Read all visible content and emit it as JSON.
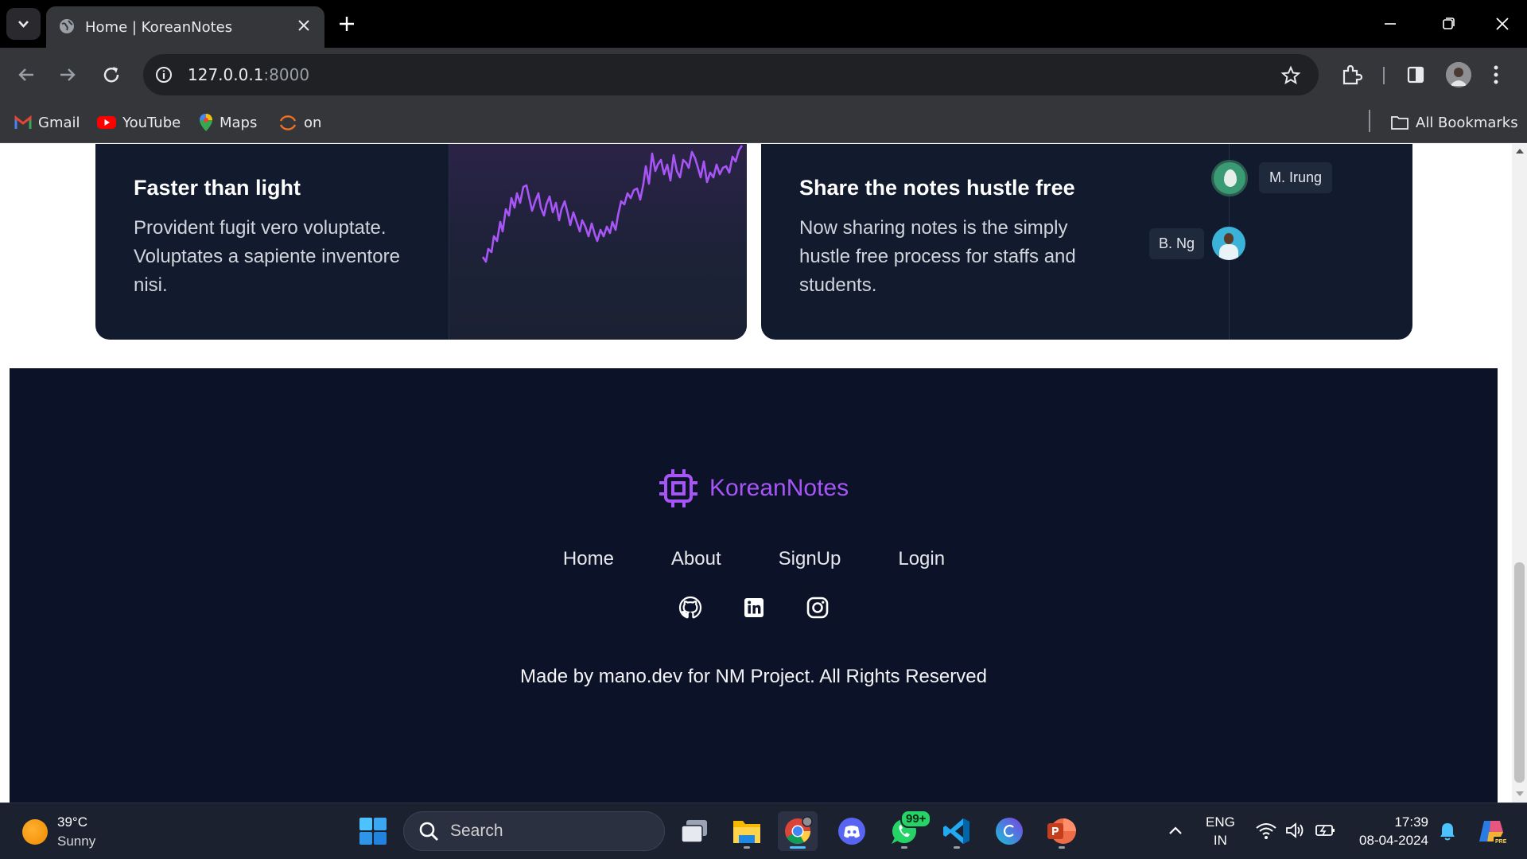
{
  "browser": {
    "tab_title": "Home | KoreanNotes",
    "url_host": "127.0.0.1",
    "url_port": ":8000",
    "bookmarks": [
      {
        "label": "Gmail",
        "icon": "gmail-icon"
      },
      {
        "label": "YouTube",
        "icon": "youtube-icon"
      },
      {
        "label": "Maps",
        "icon": "maps-icon"
      },
      {
        "label": "on",
        "icon": "site-icon"
      }
    ],
    "all_bookmarks": "All Bookmarks"
  },
  "features": [
    {
      "title": "Faster than light",
      "text": "Provident fugit vero voluptate. Voluptates a sapiente inventore nisi."
    },
    {
      "title": "Share the notes hustle free",
      "text": "Now sharing notes is the simply hustle free process for staffs and students."
    }
  ],
  "avatars": [
    {
      "name": "M. Irung"
    },
    {
      "name": "B. Ng"
    }
  ],
  "footer": {
    "brand": "KoreanNotes",
    "nav": [
      "Home",
      "About",
      "SignUp",
      "Login"
    ],
    "social": [
      "github-icon",
      "linkedin-icon",
      "instagram-icon"
    ],
    "copyright": "Made by mano.dev for NM Project. All Rights Reserved"
  },
  "taskbar": {
    "weather_temp": "39°C",
    "weather_cond": "Sunny",
    "search_placeholder": "Search",
    "whatsapp_badge": "99+",
    "lang_top": "ENG",
    "lang_bottom": "IN",
    "time": "17:39",
    "date": "08-04-2024"
  },
  "colors": {
    "brand": "#a855f7",
    "card_bg": "#121a2e",
    "footer_bg": "#0c1329"
  }
}
